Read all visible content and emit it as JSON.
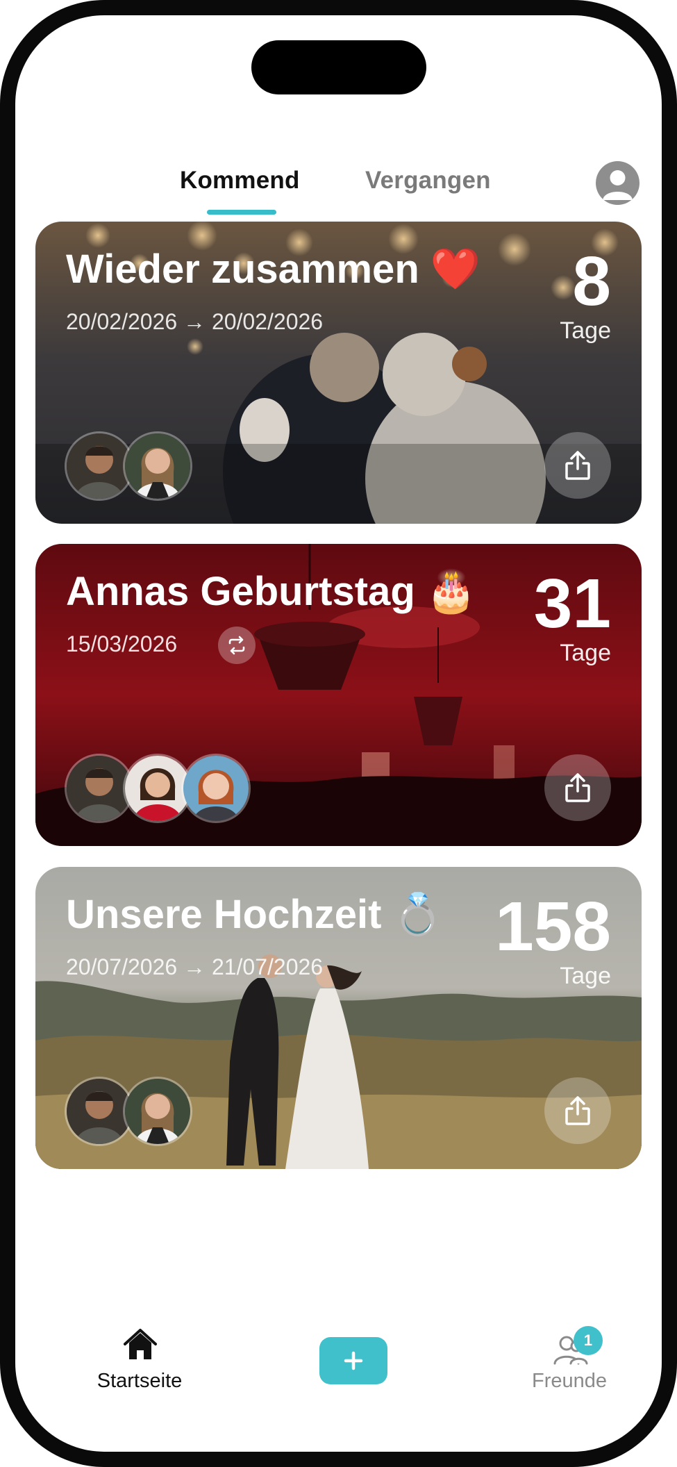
{
  "tabs": {
    "upcoming": "Kommend",
    "past": "Vergangen",
    "active": "upcoming"
  },
  "colors": {
    "accent": "#38bcc9",
    "card2_tint": "#8c1018"
  },
  "events": [
    {
      "title": "Wieder zusammen",
      "emoji": "❤️",
      "date": "20/02/2026 → 20/02/2026",
      "count": "8",
      "unit": "Tage",
      "share_icon": "share-icon",
      "people": [
        "man-avatar",
        "woman-avatar"
      ]
    },
    {
      "title": "Annas Geburtstag",
      "emoji": "🎂",
      "date": "15/03/2026",
      "recurring_icon": "repeat-icon",
      "count": "31",
      "unit": "Tage",
      "share_icon": "share-icon",
      "people": [
        "man-avatar",
        "woman-red-avatar",
        "redhead-avatar"
      ]
    },
    {
      "title": "Unsere Hochzeit",
      "emoji": "💍",
      "date": "20/07/2026 → 21/07/2026",
      "count": "158",
      "unit": "Tage",
      "share_icon": "share-icon",
      "people": [
        "man-avatar",
        "woman-avatar"
      ]
    }
  ],
  "bottom_nav": {
    "home": "Startseite",
    "add": "+",
    "friends": "Freunde",
    "friends_badge": "1"
  }
}
